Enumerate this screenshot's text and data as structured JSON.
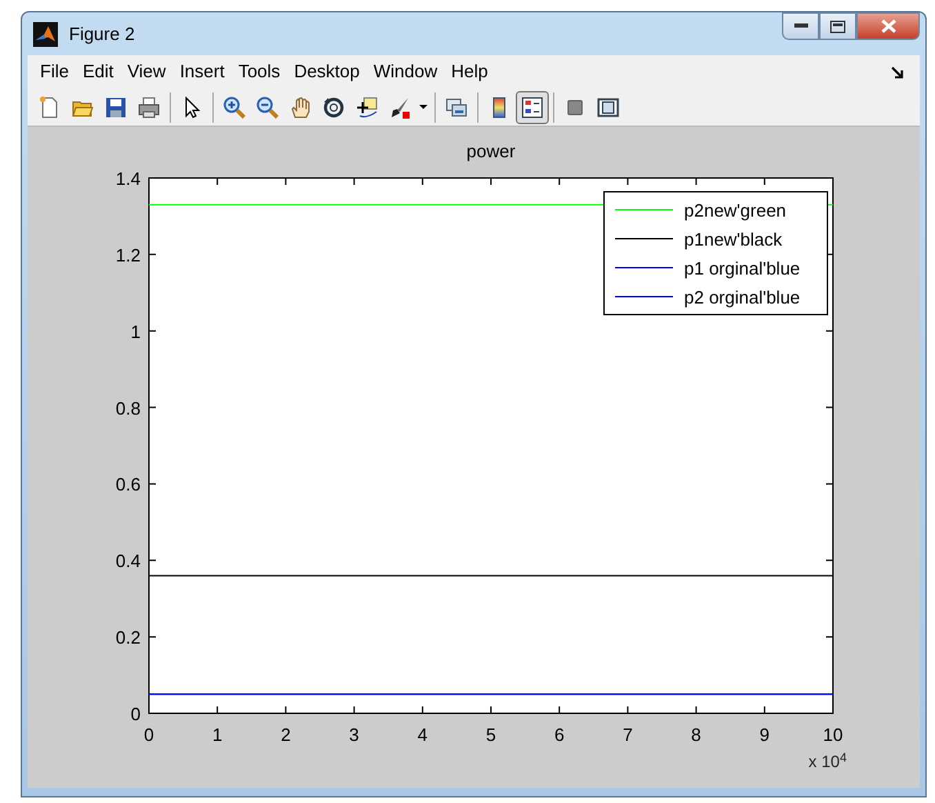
{
  "window": {
    "title": "Figure 2"
  },
  "menu": [
    "File",
    "Edit",
    "View",
    "Insert",
    "Tools",
    "Desktop",
    "Window",
    "Help"
  ],
  "toolbar": [
    [
      {
        "kind": "new",
        "pressed": false
      },
      {
        "kind": "open",
        "pressed": false
      },
      {
        "kind": "save",
        "pressed": false
      },
      {
        "kind": "print",
        "pressed": false
      }
    ],
    [
      {
        "kind": "pointer",
        "pressed": false
      }
    ],
    [
      {
        "kind": "zoomin",
        "pressed": false
      },
      {
        "kind": "zoomout",
        "pressed": false
      },
      {
        "kind": "pan",
        "pressed": false
      },
      {
        "kind": "rotate",
        "pressed": false
      },
      {
        "kind": "datacursor",
        "pressed": false
      },
      {
        "kind": "brush",
        "pressed": false
      },
      {
        "kind": "caret",
        "pressed": false
      }
    ],
    [
      {
        "kind": "link",
        "pressed": false
      }
    ],
    [
      {
        "kind": "colorbar",
        "pressed": false
      },
      {
        "kind": "legend",
        "pressed": true
      }
    ],
    [
      {
        "kind": "hideplot",
        "pressed": false
      },
      {
        "kind": "showplot",
        "pressed": false
      }
    ]
  ],
  "figure": {
    "chart_data": {
      "type": "line",
      "title": "power",
      "x": [
        0,
        10
      ],
      "series": [
        {
          "name": "p2new'green",
          "color": "#00ff00",
          "values": [
            1.33,
            1.33
          ]
        },
        {
          "name": "p1new'black",
          "color": "#000000",
          "values": [
            0.36,
            0.36
          ]
        },
        {
          "name": "p1 orginal'blue",
          "color": "#0000ff",
          "values": [
            0.05,
            0.05
          ]
        },
        {
          "name": "p2 orginal'blue",
          "color": "#0000ff",
          "values": [
            0.05,
            0.05
          ]
        }
      ],
      "xlim": [
        0,
        10
      ],
      "ylim": [
        0,
        1.4
      ],
      "xticks": [
        0,
        1,
        2,
        3,
        4,
        5,
        6,
        7,
        8,
        9,
        10
      ],
      "yticks": [
        0,
        0.2,
        0.4,
        0.6,
        0.8,
        1,
        1.2,
        1.4
      ],
      "legend": true,
      "annotations": [
        {
          "text": "x 10$^{4}$"
        }
      ]
    }
  }
}
